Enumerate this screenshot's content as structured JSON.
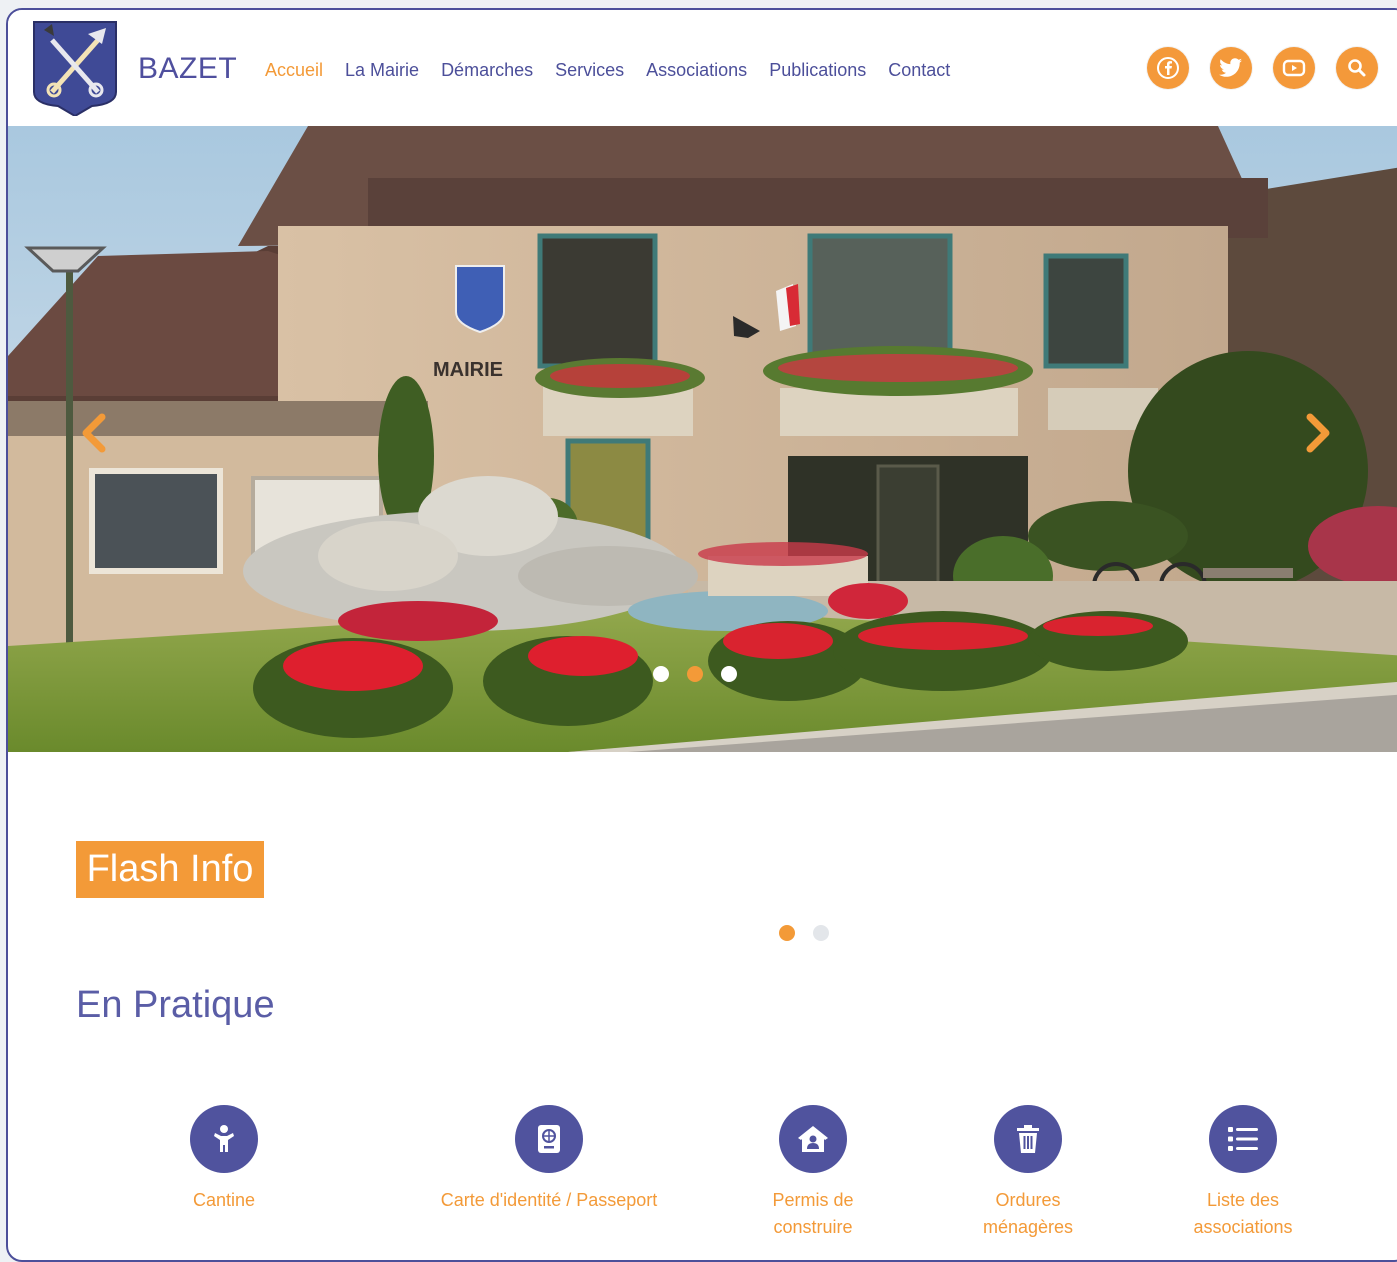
{
  "site": {
    "name": "BAZET"
  },
  "nav": {
    "items": [
      {
        "label": "Accueil",
        "active": true
      },
      {
        "label": "La Mairie"
      },
      {
        "label": "Démarches"
      },
      {
        "label": "Services"
      },
      {
        "label": "Associations"
      },
      {
        "label": "Publications"
      },
      {
        "label": "Contact"
      }
    ]
  },
  "social": [
    "facebook-icon",
    "twitter-icon",
    "youtube-icon",
    "search-icon"
  ],
  "hero": {
    "sign": "MAIRIE"
  },
  "flash": {
    "title": "Flash Info"
  },
  "pratique": {
    "title": "En Pratique",
    "items": [
      {
        "label": "Cantine",
        "icon": "child-icon"
      },
      {
        "label": "Carte d'identité / Passeport",
        "icon": "passport-icon"
      },
      {
        "label": "Permis de construire",
        "icon": "house-user-icon"
      },
      {
        "label": "Ordures ménagères",
        "icon": "trash-icon"
      },
      {
        "label": "Liste des associations",
        "icon": "list-icon"
      }
    ]
  },
  "colors": {
    "accent": "#f39a38",
    "primary": "#50539e"
  }
}
